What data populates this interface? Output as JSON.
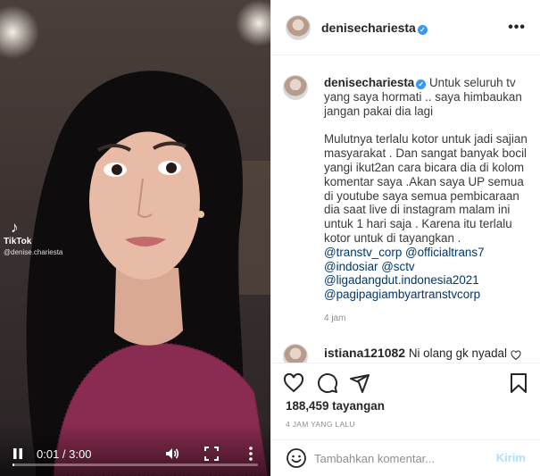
{
  "video": {
    "watermark": {
      "logo": "♪",
      "brand": "TikTok",
      "handle": "@denise.chariesta"
    },
    "controls": {
      "time": "0:01 / 3:00",
      "progress": 0.006
    }
  },
  "post": {
    "header": {
      "username": "denisechariesta"
    },
    "caption": {
      "username": "denisechariesta",
      "text_intro": "Untuk seluruh tv yang saya hormati .. saya himbaukan jangan pakai dia lagi",
      "text_body": "Mulutnya terlalu kotor untuk jadi sajian masyarakat . Dan sangat banyak bocil yangi ikut2an cara bicara dia di kolom komentar saya .Akan saya UP semua di youtube saya semua pembicaraan dia saat live di instagram malam ini untuk 1 hari saja . Karena itu terlalu kotor untuk di tayangkan .",
      "mentions": [
        "@transtv_corp @officialtrans7",
        "@indosiar @sctv",
        "@ligadangdut.indonesia2021",
        "@pagipagiambyartranstvcorp"
      ],
      "ago": "4 jam"
    },
    "comment": {
      "username": "istiana121082",
      "text": "Ni olang gk nyadal"
    },
    "likes": "188,459 tayangan",
    "timestamp": "4 JAM YANG LALU",
    "comment_box": {
      "placeholder": "Tambahkan komentar...",
      "post_label": "Kirim"
    }
  },
  "colors": {
    "link": "#00376b",
    "verified": "#3897f0",
    "post_disabled": "#b2dffc",
    "muted": "#8e8e8e"
  }
}
